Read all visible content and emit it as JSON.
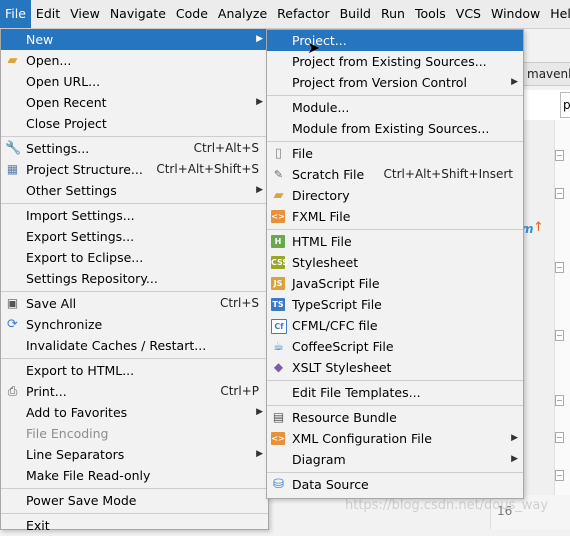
{
  "menubar": [
    "File",
    "Edit",
    "View",
    "Navigate",
    "Code",
    "Analyze",
    "Refactor",
    "Build",
    "Run",
    "Tools",
    "VCS",
    "Window",
    "Help"
  ],
  "background": {
    "tab_text": "mavenlea",
    "field_text": "p",
    "line_number": "16",
    "watermark": "https://blog.csdn.net/dous_way"
  },
  "file_menu": {
    "items": [
      {
        "label": "New",
        "submenu": true
      },
      {
        "label": "Open...",
        "icon": "folder-icon"
      },
      {
        "label": "Open URL..."
      },
      {
        "label": "Open Recent",
        "submenu": true
      },
      {
        "label": "Close Project"
      },
      {
        "label": "Settings...",
        "shortcut": "Ctrl+Alt+S",
        "icon": "wrench-icon"
      },
      {
        "label": "Project Structure...",
        "shortcut": "Ctrl+Alt+Shift+S",
        "icon": "project-structure-icon"
      },
      {
        "label": "Other Settings",
        "submenu": true
      },
      {
        "label": "Import Settings..."
      },
      {
        "label": "Export Settings..."
      },
      {
        "label": "Export to Eclipse..."
      },
      {
        "label": "Settings Repository..."
      },
      {
        "label": "Save All",
        "shortcut": "Ctrl+S",
        "icon": "save-icon"
      },
      {
        "label": "Synchronize",
        "icon": "sync-icon"
      },
      {
        "label": "Invalidate Caches / Restart..."
      },
      {
        "label": "Export to HTML..."
      },
      {
        "label": "Print...",
        "shortcut": "Ctrl+P",
        "icon": "print-icon"
      },
      {
        "label": "Add to Favorites",
        "submenu": true
      },
      {
        "label": "File Encoding",
        "disabled": true
      },
      {
        "label": "Line Separators",
        "submenu": true
      },
      {
        "label": "Make File Read-only"
      },
      {
        "label": "Power Save Mode"
      },
      {
        "label": "Exit"
      }
    ]
  },
  "new_menu": {
    "items": [
      {
        "label": "Project..."
      },
      {
        "label": "Project from Existing Sources..."
      },
      {
        "label": "Project from Version Control",
        "submenu": true
      },
      {
        "label": "Module..."
      },
      {
        "label": "Module from Existing Sources..."
      },
      {
        "label": "File",
        "icon": "file-icon"
      },
      {
        "label": "Scratch File",
        "shortcut": "Ctrl+Alt+Shift+Insert",
        "icon": "scratch-file-icon"
      },
      {
        "label": "Directory",
        "icon": "directory-icon"
      },
      {
        "label": "FXML File",
        "icon": "fxml-file-icon"
      },
      {
        "label": "HTML File",
        "icon": "html-file-icon"
      },
      {
        "label": "Stylesheet",
        "icon": "css-file-icon"
      },
      {
        "label": "JavaScript File",
        "icon": "js-file-icon"
      },
      {
        "label": "TypeScript File",
        "icon": "ts-file-icon"
      },
      {
        "label": "CFML/CFC file",
        "icon": "cfml-file-icon"
      },
      {
        "label": "CoffeeScript File",
        "icon": "coffeescript-file-icon"
      },
      {
        "label": "XSLT Stylesheet",
        "icon": "xslt-file-icon"
      },
      {
        "label": "Edit File Templates..."
      },
      {
        "label": "Resource Bundle",
        "icon": "resource-bundle-icon"
      },
      {
        "label": "XML Configuration File",
        "submenu": true,
        "icon": "xml-config-icon"
      },
      {
        "label": "Diagram",
        "submenu": true,
        "icon": "diagram-icon"
      },
      {
        "label": "Data Source",
        "icon": "data-source-icon"
      }
    ]
  }
}
